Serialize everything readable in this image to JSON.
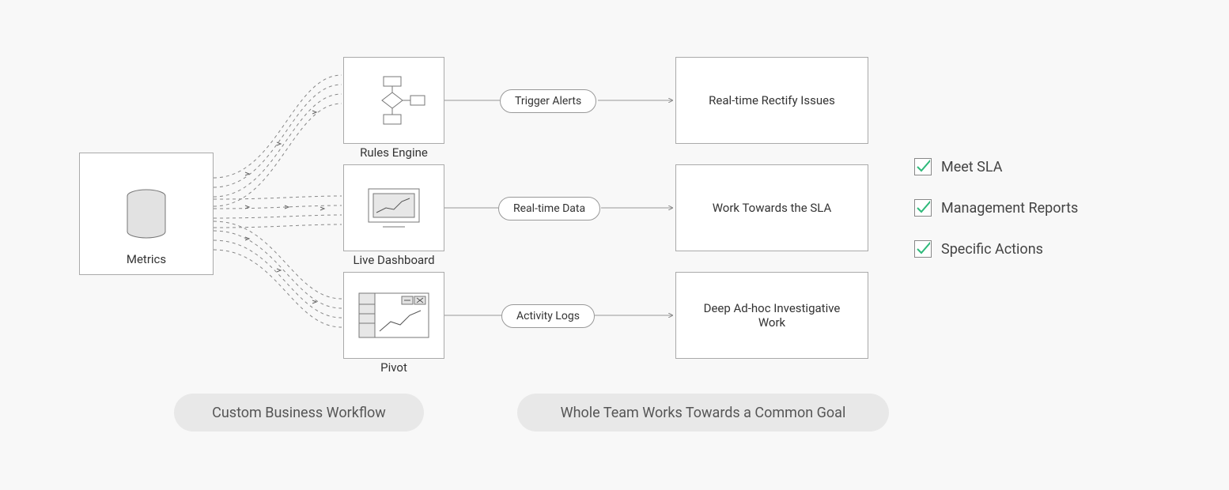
{
  "metrics": {
    "label": "Metrics"
  },
  "components": {
    "rules_engine": {
      "label": "Rules Engine"
    },
    "live_dashboard": {
      "label": "Live Dashboard"
    },
    "pivot": {
      "label": "Pivot"
    }
  },
  "pills": {
    "trigger_alerts": "Trigger Alerts",
    "realtime_data": "Real-time Data",
    "activity_logs": "Activity Logs"
  },
  "results": {
    "rectify": "Real-time Rectify Issues",
    "work_sla": "Work Towards the SLA",
    "investigative": "Deep Ad-hoc Investigative Work"
  },
  "bottom": {
    "left": "Custom Business Workflow",
    "right": "Whole Team Works Towards a Common Goal"
  },
  "checks": {
    "meet_sla": "Meet SLA",
    "mgmt_reports": "Management Reports",
    "specific_actions": "Specific Actions"
  }
}
